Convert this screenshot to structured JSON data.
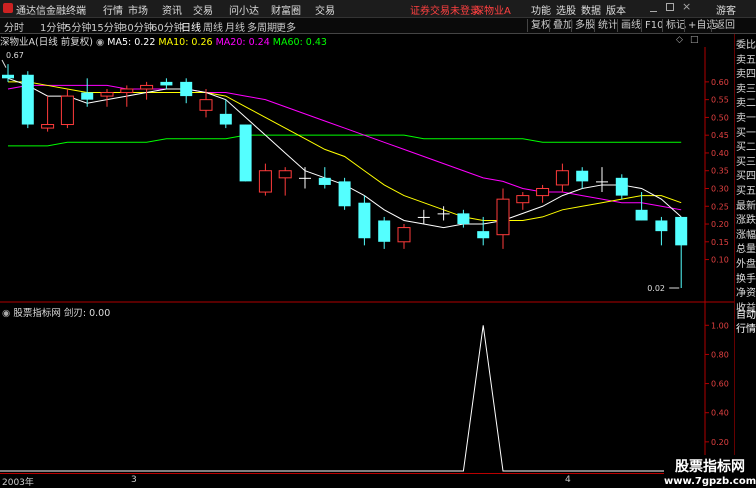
{
  "titlebar": {
    "app_name": "通达信金融终端",
    "menus": [
      "行情",
      "市场",
      "资讯",
      "交易",
      "问小达",
      "财富圈",
      "交易"
    ],
    "login_notice": "证券交易未登录",
    "stock_name": "深物业A",
    "right_menus": [
      "功能",
      "选股",
      "数据",
      "版本",
      "游客"
    ]
  },
  "toolbar": {
    "periods": [
      "分时",
      "1分钟",
      "5分钟",
      "15分钟",
      "30分钟",
      "60分钟",
      "日线",
      "周线",
      "月线",
      "多周期",
      "更多"
    ],
    "active_period": "日线",
    "buttons": [
      "复权",
      "叠加",
      "多股",
      "统计",
      "画线",
      "F10",
      "标记",
      "+自选",
      "返回"
    ]
  },
  "infoline": {
    "title": "深物业A(日线 前复权)",
    "ma": [
      {
        "label": "MA5: 0.22",
        "color": "#ffffff"
      },
      {
        "label": "MA10: 0.26",
        "color": "#ffff00"
      },
      {
        "label": "MA20: 0.24",
        "color": "#ff00ff"
      },
      {
        "label": "MA60: 0.43",
        "color": "#00ff00"
      }
    ]
  },
  "price_axis": {
    "labels": [
      "0.60",
      "0.55",
      "0.50",
      "0.45",
      "0.40",
      "0.35",
      "0.30",
      "0.25",
      "0.20",
      "0.15",
      "0.10"
    ],
    "high_marker": "0.67",
    "low_marker": "0.02"
  },
  "indicator": {
    "title": "股票指标网",
    "value_label": "剑刃: 0.00",
    "axis_labels": [
      "1.00",
      "0.80",
      "0.60",
      "0.40",
      "0.20"
    ]
  },
  "xaxis": {
    "labels": [
      "2003年",
      "3",
      "4"
    ]
  },
  "right_panel": {
    "items": [
      "委比",
      "卖五",
      "卖四",
      "卖三",
      "卖二",
      "卖一",
      "买一",
      "买二",
      "买三",
      "买四",
      "买五",
      "最新",
      "涨跌",
      "涨幅",
      "总量",
      "外盘",
      "换手",
      "净资",
      "收益",
      "自动",
      "行情"
    ]
  },
  "watermark": {
    "line1": "股票指标网",
    "line2": "www.7gpzb.com"
  },
  "colors": {
    "up": "#ff3b3b",
    "down": "#54ffff",
    "ma5": "#ffffff",
    "ma10": "#ffff00",
    "ma20": "#ff00ff",
    "ma60": "#00ff00",
    "axis": "#b00000",
    "indicator_line": "#ffffff"
  },
  "chart_data": {
    "type": "candlestick",
    "ylim": [
      0.02,
      0.67
    ],
    "candles": [
      {
        "o": 0.62,
        "h": 0.65,
        "l": 0.6,
        "c": 0.61
      },
      {
        "o": 0.62,
        "h": 0.63,
        "l": 0.47,
        "c": 0.48
      },
      {
        "o": 0.47,
        "h": 0.56,
        "l": 0.46,
        "c": 0.48
      },
      {
        "o": 0.48,
        "h": 0.58,
        "l": 0.47,
        "c": 0.56
      },
      {
        "o": 0.57,
        "h": 0.61,
        "l": 0.53,
        "c": 0.55
      },
      {
        "o": 0.56,
        "h": 0.58,
        "l": 0.53,
        "c": 0.57
      },
      {
        "o": 0.57,
        "h": 0.59,
        "l": 0.53,
        "c": 0.58
      },
      {
        "o": 0.58,
        "h": 0.6,
        "l": 0.55,
        "c": 0.59
      },
      {
        "o": 0.6,
        "h": 0.61,
        "l": 0.58,
        "c": 0.59
      },
      {
        "o": 0.6,
        "h": 0.61,
        "l": 0.54,
        "c": 0.56
      },
      {
        "o": 0.52,
        "h": 0.58,
        "l": 0.5,
        "c": 0.55
      },
      {
        "o": 0.51,
        "h": 0.55,
        "l": 0.47,
        "c": 0.48
      },
      {
        "o": 0.48,
        "h": 0.48,
        "l": 0.32,
        "c": 0.32
      },
      {
        "o": 0.29,
        "h": 0.37,
        "l": 0.28,
        "c": 0.35
      },
      {
        "o": 0.33,
        "h": 0.36,
        "l": 0.28,
        "c": 0.35
      },
      {
        "o": 0.33,
        "h": 0.36,
        "l": 0.3,
        "c": 0.33
      },
      {
        "o": 0.33,
        "h": 0.36,
        "l": 0.3,
        "c": 0.31
      },
      {
        "o": 0.32,
        "h": 0.33,
        "l": 0.24,
        "c": 0.25
      },
      {
        "o": 0.26,
        "h": 0.28,
        "l": 0.14,
        "c": 0.16
      },
      {
        "o": 0.21,
        "h": 0.22,
        "l": 0.13,
        "c": 0.15
      },
      {
        "o": 0.15,
        "h": 0.2,
        "l": 0.13,
        "c": 0.19
      },
      {
        "o": 0.22,
        "h": 0.24,
        "l": 0.2,
        "c": 0.22
      },
      {
        "o": 0.23,
        "h": 0.25,
        "l": 0.21,
        "c": 0.23
      },
      {
        "o": 0.23,
        "h": 0.24,
        "l": 0.19,
        "c": 0.2
      },
      {
        "o": 0.18,
        "h": 0.22,
        "l": 0.14,
        "c": 0.16
      },
      {
        "o": 0.17,
        "h": 0.3,
        "l": 0.13,
        "c": 0.27
      },
      {
        "o": 0.26,
        "h": 0.29,
        "l": 0.24,
        "c": 0.28
      },
      {
        "o": 0.28,
        "h": 0.31,
        "l": 0.26,
        "c": 0.3
      },
      {
        "o": 0.31,
        "h": 0.37,
        "l": 0.29,
        "c": 0.35
      },
      {
        "o": 0.35,
        "h": 0.36,
        "l": 0.3,
        "c": 0.32
      },
      {
        "o": 0.32,
        "h": 0.36,
        "l": 0.29,
        "c": 0.32
      },
      {
        "o": 0.33,
        "h": 0.34,
        "l": 0.27,
        "c": 0.28
      },
      {
        "o": 0.24,
        "h": 0.29,
        "l": 0.21,
        "c": 0.21
      },
      {
        "o": 0.21,
        "h": 0.22,
        "l": 0.14,
        "c": 0.18
      },
      {
        "o": 0.22,
        "h": 0.22,
        "l": 0.02,
        "c": 0.14
      }
    ],
    "ma5": [
      0.61,
      0.59,
      0.56,
      0.56,
      0.54,
      0.55,
      0.56,
      0.57,
      0.58,
      0.58,
      0.57,
      0.55,
      0.5,
      0.45,
      0.4,
      0.35,
      0.33,
      0.31,
      0.28,
      0.24,
      0.21,
      0.2,
      0.19,
      0.2,
      0.2,
      0.21,
      0.23,
      0.25,
      0.28,
      0.3,
      0.31,
      0.31,
      0.3,
      0.27,
      0.22
    ],
    "ma10": [
      0.6,
      0.6,
      0.59,
      0.58,
      0.57,
      0.57,
      0.57,
      0.57,
      0.57,
      0.57,
      0.57,
      0.56,
      0.53,
      0.5,
      0.47,
      0.44,
      0.41,
      0.39,
      0.35,
      0.31,
      0.28,
      0.26,
      0.24,
      0.22,
      0.21,
      0.21,
      0.21,
      0.22,
      0.24,
      0.25,
      0.26,
      0.27,
      0.28,
      0.28,
      0.26
    ],
    "ma20": [
      0.58,
      0.59,
      0.59,
      0.59,
      0.59,
      0.59,
      0.58,
      0.58,
      0.58,
      0.58,
      0.57,
      0.57,
      0.56,
      0.55,
      0.53,
      0.51,
      0.49,
      0.47,
      0.45,
      0.43,
      0.41,
      0.39,
      0.37,
      0.35,
      0.33,
      0.32,
      0.3,
      0.29,
      0.29,
      0.28,
      0.27,
      0.26,
      0.26,
      0.25,
      0.24
    ],
    "ma60": [
      0.42,
      0.42,
      0.42,
      0.43,
      0.43,
      0.43,
      0.43,
      0.43,
      0.44,
      0.44,
      0.44,
      0.44,
      0.45,
      0.45,
      0.45,
      0.45,
      0.45,
      0.45,
      0.45,
      0.45,
      0.45,
      0.44,
      0.44,
      0.44,
      0.44,
      0.44,
      0.44,
      0.43,
      0.43,
      0.43,
      0.43,
      0.43,
      0.43,
      0.43,
      0.43
    ],
    "indicator": {
      "ylim": [
        0,
        1.05
      ],
      "values": [
        0,
        0,
        0,
        0,
        0,
        0,
        0,
        0,
        0,
        0,
        0,
        0,
        0,
        0,
        0,
        0,
        0,
        0,
        0,
        0,
        0,
        0,
        0,
        0,
        1.0,
        0,
        0,
        0,
        0,
        0,
        0,
        0,
        0,
        0,
        0
      ]
    }
  }
}
